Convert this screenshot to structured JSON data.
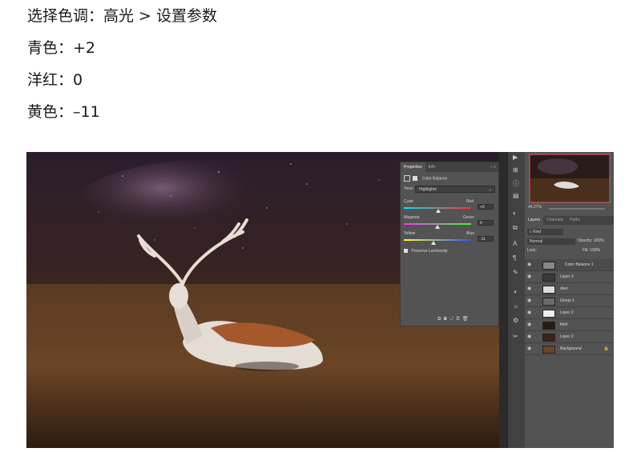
{
  "instructions": {
    "line1": "选择色调：高光 > 设置参数",
    "line2": "青色：+2",
    "line3": "洋红：0",
    "line4": "黄色：–11"
  },
  "photoshop": {
    "properties_panel": {
      "tabs": [
        "Properties",
        "Info"
      ],
      "title": "Color Balance",
      "tone_label": "Tone:",
      "tone_value": "Highlights",
      "sliders": [
        {
          "left": "Cyan",
          "right": "Red",
          "value": "+2",
          "level": 2
        },
        {
          "left": "Magenta",
          "right": "Green",
          "value": "0",
          "level": 0
        },
        {
          "left": "Yellow",
          "right": "Blue",
          "value": "-11",
          "level": -11
        }
      ],
      "preserve_luminosity": "Preserve Luminosity"
    },
    "navigator": {
      "zoom": "44.27%"
    },
    "layers_panel": {
      "tabs": [
        "Layers",
        "Channels",
        "Paths"
      ],
      "kind": "Kind",
      "blend_mode": "Normal",
      "opacity_label": "Opacity:",
      "opacity": "100%",
      "lock_label": "Lock:",
      "fill_label": "Fill:",
      "fill": "100%",
      "layers": [
        {
          "name": "Color Balance 1",
          "selected": true
        },
        {
          "name": "Layer 3",
          "selected": false
        },
        {
          "name": "deer",
          "selected": false
        },
        {
          "name": "Group 1",
          "selected": false
        },
        {
          "name": "Layer 2",
          "selected": false
        },
        {
          "name": "field",
          "selected": false
        },
        {
          "name": "Layer 2",
          "selected": false
        },
        {
          "name": "Background",
          "selected": false
        }
      ]
    }
  },
  "colors": {
    "panel": "#535353",
    "panel_dark": "#424242",
    "canvas_bg": "#2b2b2b"
  }
}
